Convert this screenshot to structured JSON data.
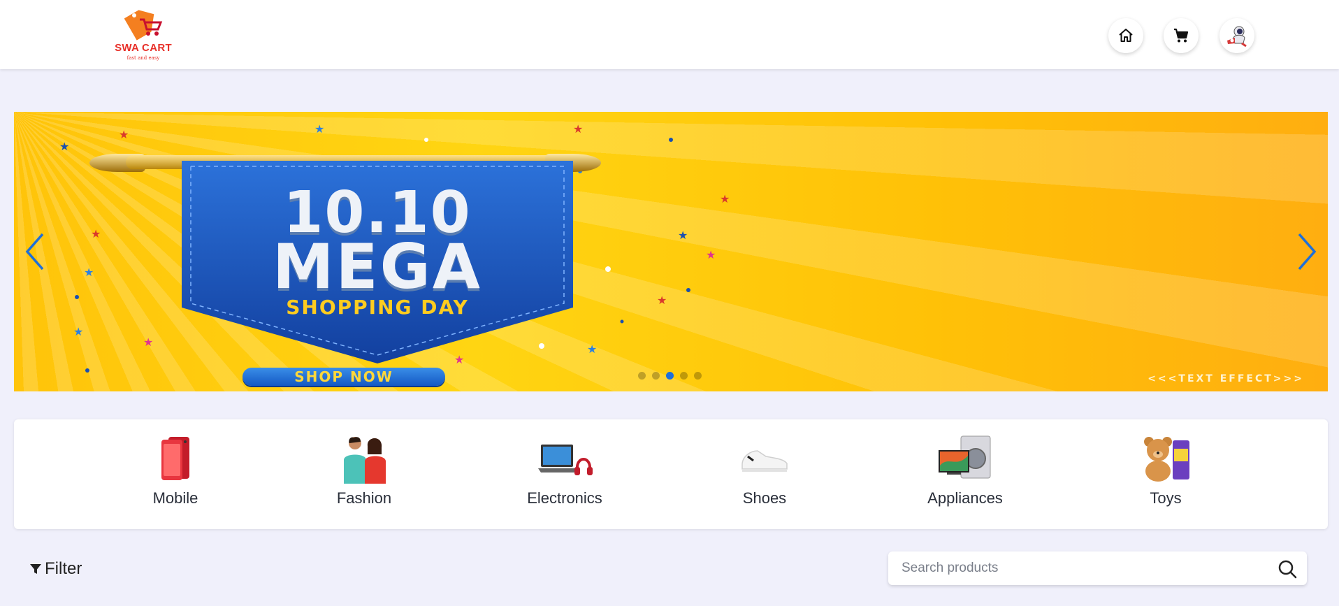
{
  "brand": {
    "name": "SWA CART",
    "tagline": "fast and easy",
    "color": "#e8312a"
  },
  "header_nav": {
    "home_icon": "home-icon",
    "cart_icon": "cart-icon",
    "profile_icon": "astronaut-avatar-icon"
  },
  "banner": {
    "headline_line1": "10.10",
    "headline_line2": "MEGA",
    "headline_line3": "SHOPPING DAY",
    "cta_label": "SHOP NOW",
    "watermark": "<<<TEXT EFFECT>>>",
    "slide_count": 5,
    "active_slide": 3,
    "prev_icon": "chevron-left-icon",
    "next_icon": "chevron-right-icon",
    "accent_color": "#1e6fd9"
  },
  "categories": [
    {
      "label": "Mobile",
      "icon": "mobile-phone-image"
    },
    {
      "label": "Fashion",
      "icon": "fashion-models-image"
    },
    {
      "label": "Electronics",
      "icon": "laptop-headphones-image"
    },
    {
      "label": "Shoes",
      "icon": "sneaker-image"
    },
    {
      "label": "Appliances",
      "icon": "tv-washer-image"
    },
    {
      "label": "Toys",
      "icon": "teddy-bear-toys-image"
    }
  ],
  "filter": {
    "label": "Filter",
    "icon": "funnel-icon"
  },
  "search": {
    "placeholder": "Search products",
    "value": "",
    "icon": "search-icon"
  }
}
